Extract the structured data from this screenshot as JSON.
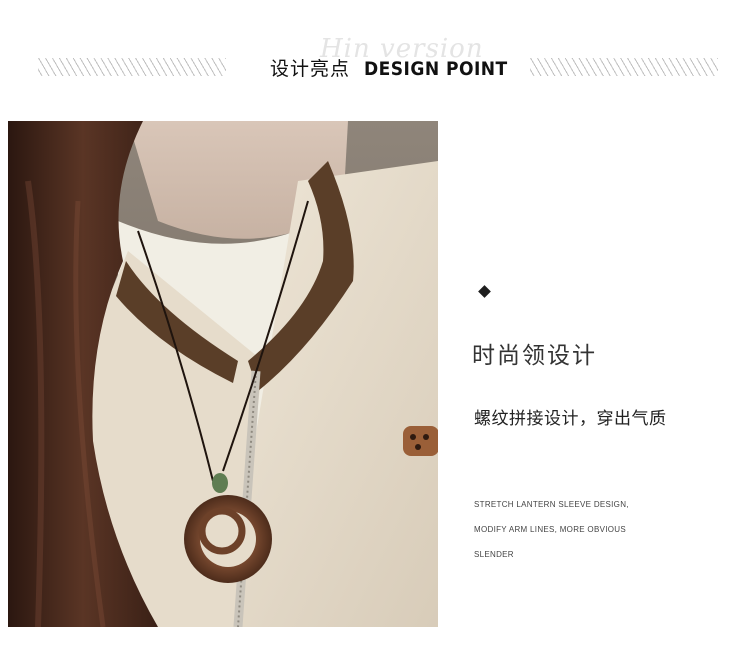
{
  "header": {
    "script_text": "Hin version",
    "title_cn": "设计亮点",
    "title_en": "DESIGN POINT"
  },
  "photo": {
    "alt": "necklace-on-jacket-photo"
  },
  "feature": {
    "title": "时尚领设计",
    "subtitle": "螺纹拼接设计，穿出气质",
    "description_lines": [
      "STRETCH LANTERN SLEEVE DESIGN,",
      "MODIFY ARM LINES, MORE OBVIOUS",
      "SLENDER"
    ]
  },
  "colors": {
    "background": "#ffffff",
    "text_dark": "#222222",
    "rib_collar": "#5a3e28",
    "jacket": "#e8dfcf",
    "wood_ring": "#6a3f28"
  }
}
